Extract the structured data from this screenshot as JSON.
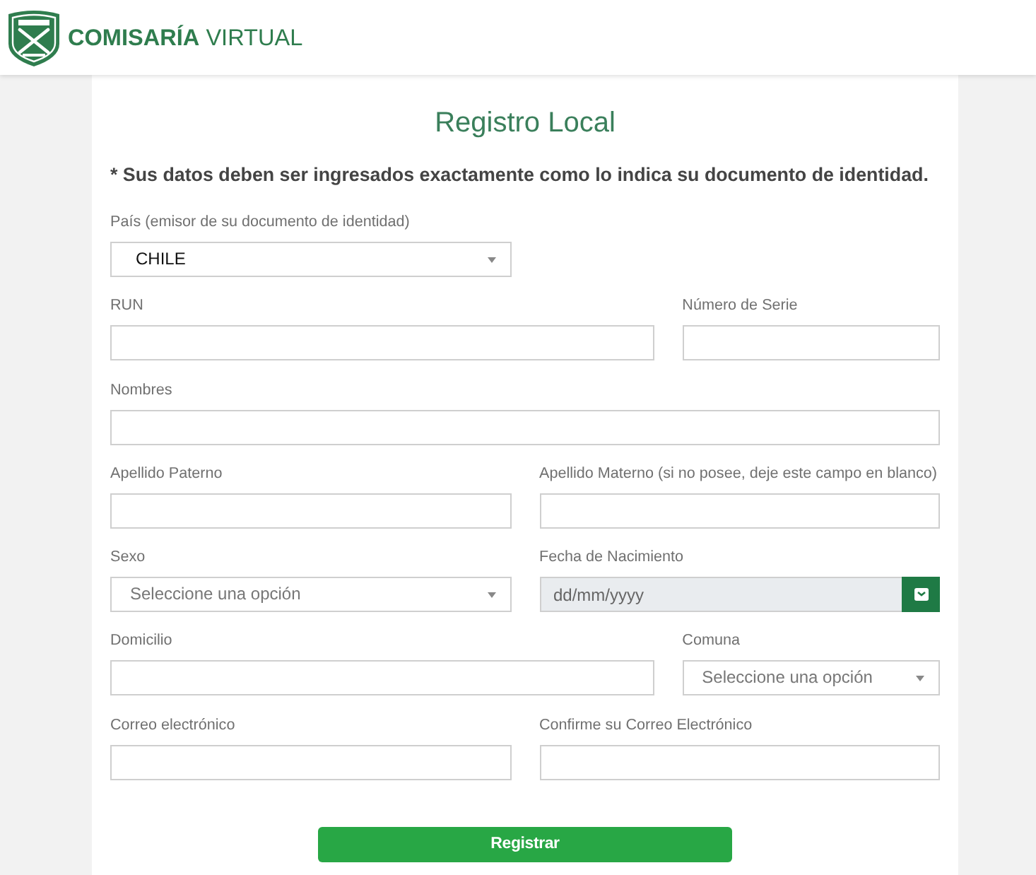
{
  "header": {
    "brand": "**COMISARÍA** VIRTUAL"
  },
  "form": {
    "title": "Registro Local",
    "notice": "* Sus datos deben ser ingresados exactamente como lo indica su documento de identidad.",
    "rows": [
      [
        {
          "kind": "select",
          "label": "País (emisor de su documento de identidad)",
          "value": "CHILE"
        }
      ],
      [
        {
          "kind": "text",
          "label": "RUN"
        },
        {
          "kind": "text",
          "label": "Número de Serie"
        }
      ],
      [
        {
          "kind": "text",
          "label": "Nombres"
        }
      ],
      [
        {
          "kind": "text",
          "label": "Apellido Paterno"
        },
        {
          "kind": "text",
          "label": "Apellido Materno (si no posee, deje este campo en blanco)"
        }
      ],
      [
        {
          "kind": "select",
          "label": "Sexo",
          "placeholder": "Seleccione una opción"
        },
        {
          "kind": "date",
          "label": "Fecha de Nacimiento",
          "placeholder": "dd/mm/yyyy"
        }
      ],
      [
        {
          "kind": "text",
          "label": "Domicilio"
        },
        {
          "kind": "select",
          "label": "Comuna",
          "placeholder": "Seleccione una opción"
        }
      ],
      [
        {
          "kind": "text",
          "label": "Correo electrónico"
        },
        {
          "kind": "text",
          "label": "Confirme su Correo Electrónico"
        }
      ]
    ],
    "submit": "Registrar"
  }
}
